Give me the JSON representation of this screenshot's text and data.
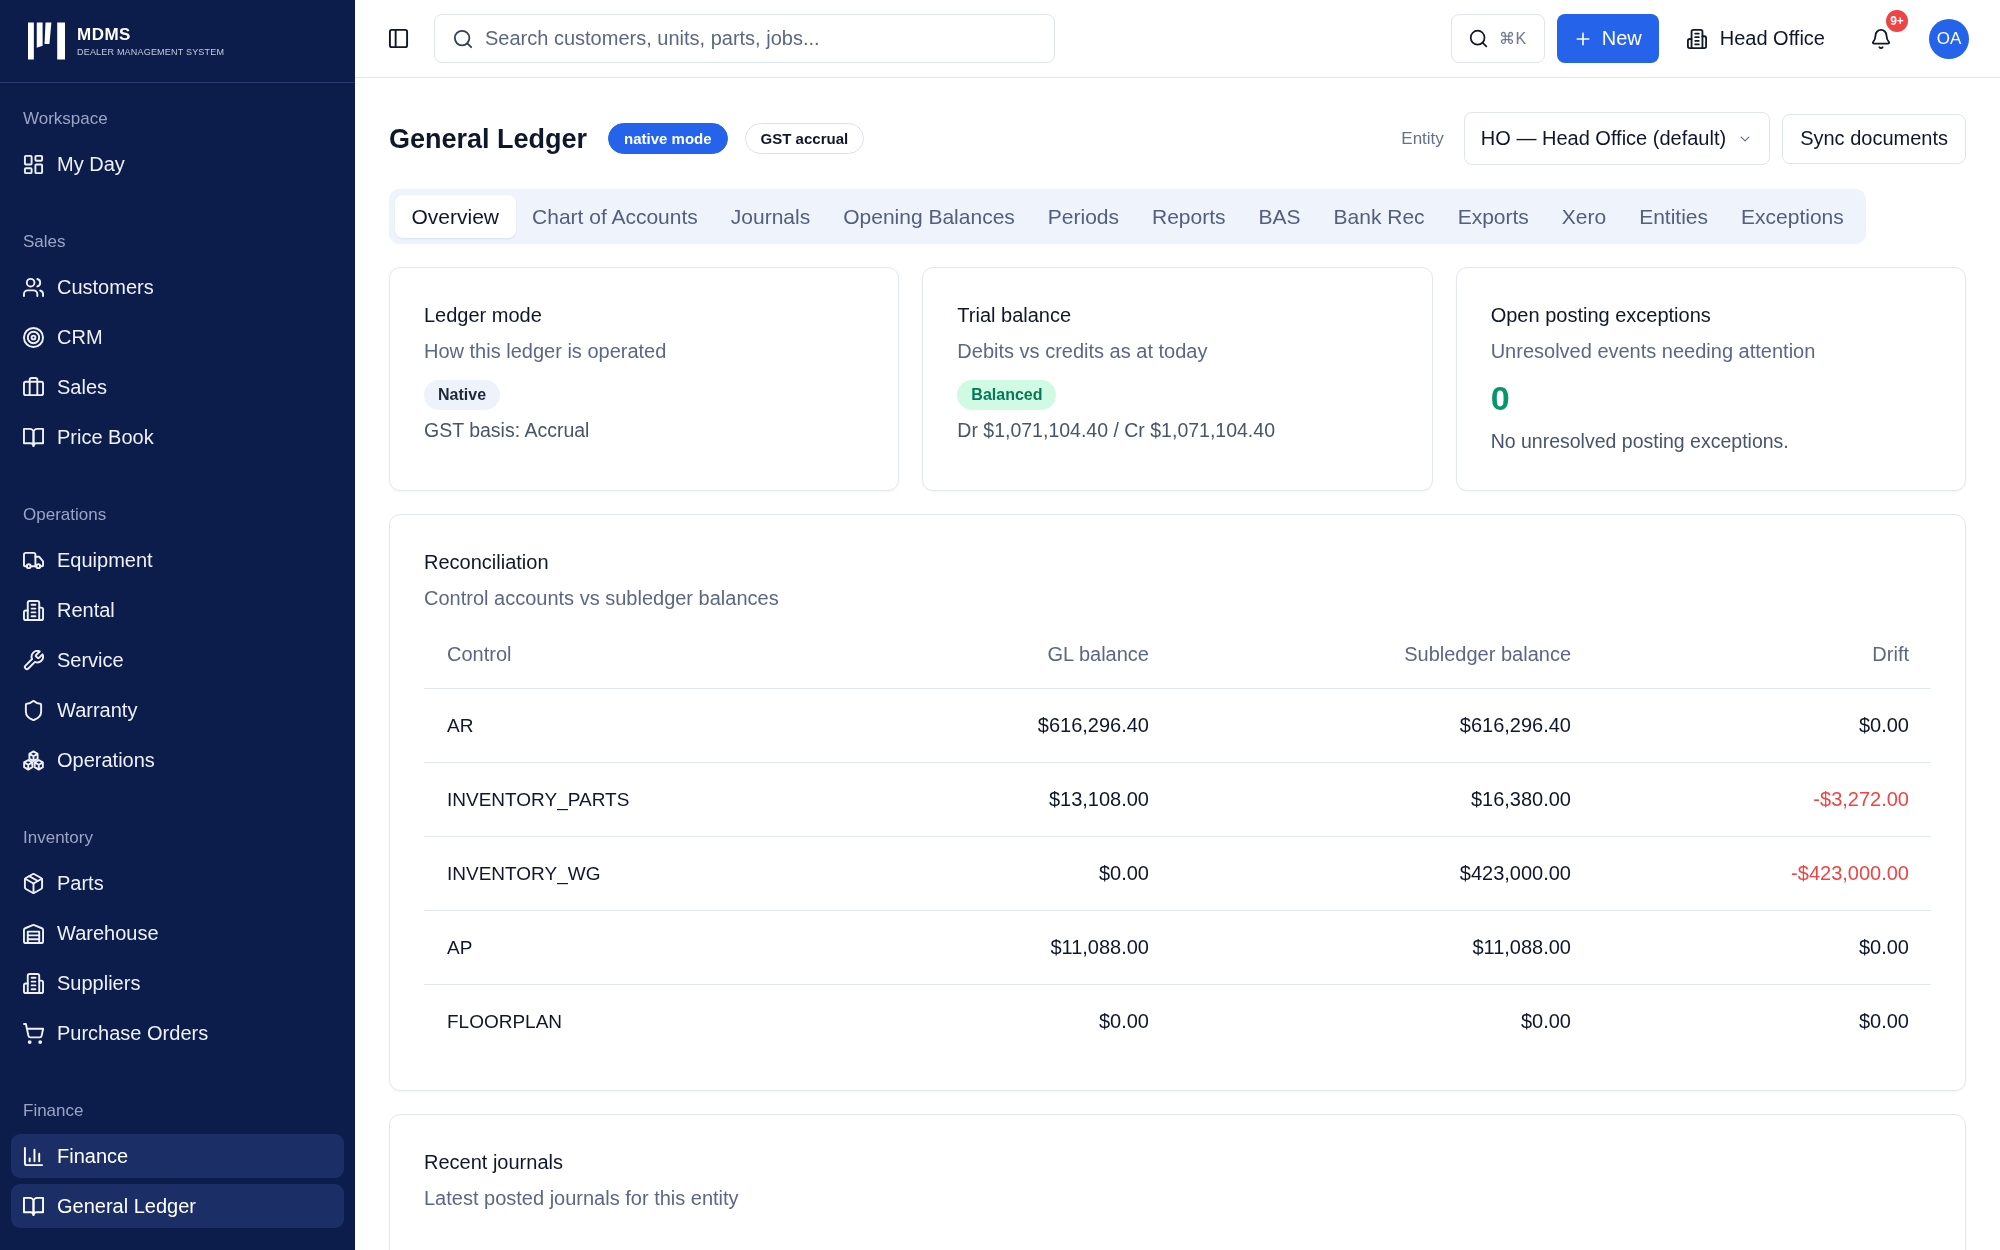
{
  "sidebar": {
    "logo": {
      "name": "MDMS",
      "tagline": "DEALER MANAGEMENT SYSTEM"
    },
    "sections": [
      {
        "title": "Workspace",
        "items": [
          {
            "label": "My Day",
            "selected": false
          }
        ]
      },
      {
        "title": "Sales",
        "items": [
          {
            "label": "Customers",
            "selected": false
          },
          {
            "label": "CRM",
            "selected": false
          },
          {
            "label": "Sales",
            "selected": false
          },
          {
            "label": "Price Book",
            "selected": false
          }
        ]
      },
      {
        "title": "Operations",
        "items": [
          {
            "label": "Equipment",
            "selected": false
          },
          {
            "label": "Rental",
            "selected": false
          },
          {
            "label": "Service",
            "selected": false
          },
          {
            "label": "Warranty",
            "selected": false
          },
          {
            "label": "Operations",
            "selected": false
          }
        ]
      },
      {
        "title": "Inventory",
        "items": [
          {
            "label": "Parts",
            "selected": false
          },
          {
            "label": "Warehouse",
            "selected": false
          },
          {
            "label": "Suppliers",
            "selected": false
          },
          {
            "label": "Purchase Orders",
            "selected": false
          }
        ]
      },
      {
        "title": "Finance",
        "items": [
          {
            "label": "Finance",
            "selected": true
          },
          {
            "label": "General Ledger",
            "selected": true
          }
        ]
      }
    ]
  },
  "topbar": {
    "search": {
      "placeholder": "Search customers, units, parts, jobs..."
    },
    "shortcut": "⌘K",
    "new_button": "New",
    "location": "Head Office",
    "notification_count": "9+",
    "avatar": "OA"
  },
  "page": {
    "title": "General Ledger",
    "badges": [
      {
        "label": "native mode",
        "kind": "solid"
      },
      {
        "label": "GST accrual",
        "kind": "outline"
      }
    ],
    "entity_label": "Entity",
    "entity_select": "HO — Head Office (default)",
    "sync_button": "Sync documents"
  },
  "tabs": [
    {
      "label": "Overview",
      "selected": true
    },
    {
      "label": "Chart of Accounts",
      "selected": false
    },
    {
      "label": "Journals",
      "selected": false
    },
    {
      "label": "Opening Balances",
      "selected": false
    },
    {
      "label": "Periods",
      "selected": false
    },
    {
      "label": "Reports",
      "selected": false
    },
    {
      "label": "BAS",
      "selected": false
    },
    {
      "label": "Bank Rec",
      "selected": false
    },
    {
      "label": "Exports",
      "selected": false
    },
    {
      "label": "Xero",
      "selected": false
    },
    {
      "label": "Entities",
      "selected": false
    },
    {
      "label": "Exceptions",
      "selected": false
    }
  ],
  "summary_cards": [
    {
      "kind": "status",
      "title": "Ledger mode",
      "subtitle": "How this ledger is operated",
      "badge": {
        "label": "Native",
        "kind": "neutral"
      },
      "detail": "GST basis: Accrual"
    },
    {
      "kind": "status",
      "title": "Trial balance",
      "subtitle": "Debits vs credits as at today",
      "badge": {
        "label": "Balanced",
        "kind": "success"
      },
      "detail": "Dr $1,071,104.40 / Cr $1,071,104.40"
    },
    {
      "kind": "count",
      "title": "Open posting exceptions",
      "subtitle": "Unresolved events needing attention",
      "count": "0",
      "detail": "No unresolved posting exceptions."
    }
  ],
  "reconciliation": {
    "title": "Reconciliation",
    "subtitle": "Control accounts vs subledger balances",
    "columns": [
      "Control",
      "GL balance",
      "Subledger balance",
      "Drift"
    ],
    "rows": [
      {
        "cells": [
          "AR",
          "$616,296.40",
          "$616,296.40",
          "$0.00"
        ],
        "drift_negative": false
      },
      {
        "cells": [
          "INVENTORY_PARTS",
          "$13,108.00",
          "$16,380.00",
          "-$3,272.00"
        ],
        "drift_negative": true
      },
      {
        "cells": [
          "INVENTORY_WG",
          "$0.00",
          "$423,000.00",
          "-$423,000.00"
        ],
        "drift_negative": true
      },
      {
        "cells": [
          "AP",
          "$11,088.00",
          "$11,088.00",
          "$0.00"
        ],
        "drift_negative": false
      },
      {
        "cells": [
          "FLOORPLAN",
          "$0.00",
          "$0.00",
          "$0.00"
        ],
        "drift_negative": false
      }
    ]
  },
  "recent_journals": {
    "title": "Recent journals",
    "subtitle": "Latest posted journals for this entity"
  }
}
